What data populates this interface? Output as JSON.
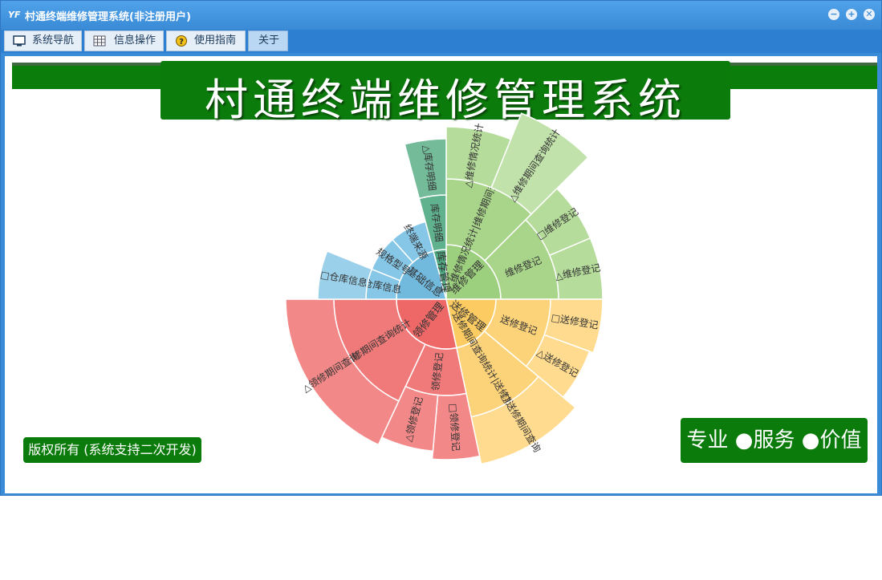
{
  "window": {
    "title": "村通终端维修管理系统(非注册用户)",
    "app_icon": "YF",
    "minimize_glyph": "−",
    "maximize_glyph": "+",
    "close_glyph": "✕"
  },
  "menu": {
    "tabs": [
      {
        "label": "系统导航",
        "icon": "monitor-icon"
      },
      {
        "label": "信息操作",
        "icon": "grid-icon"
      },
      {
        "label": "使用指南",
        "icon": "help-icon"
      },
      {
        "label": "关于",
        "icon": ""
      }
    ]
  },
  "banner": {
    "title": "村通终端维修管理系统"
  },
  "footer": {
    "copyright": "版权所有 (系统支持二次开发)",
    "slogan": "专业 ●服务 ●价值"
  },
  "sunburst": {
    "inner": [
      {
        "label": "维修管理",
        "color": "#9ccf7e"
      },
      {
        "label": "送修管理",
        "color": "#fccc62"
      },
      {
        "label": "领修管理",
        "color": "#ee6868"
      },
      {
        "label": "基础信息",
        "color": "#71bade"
      },
      {
        "label": "库存管理",
        "color": "#4fa882"
      }
    ],
    "middle": [
      {
        "label": "维修情况统计|维修期间查询统计",
        "color": "#a8d58a"
      },
      {
        "label": "维修登记",
        "color": "#a8d58a"
      },
      {
        "label": "送修登记",
        "color": "#fdd37a"
      },
      {
        "label": "送修期间查询统计|送修期间查询",
        "color": "#fdd37a"
      },
      {
        "label": "领修登记",
        "color": "#f07a7a"
      },
      {
        "label": "领修期间查询统计",
        "color": "#f07a7a"
      },
      {
        "label": "仓库信息",
        "color": "#86c6e6"
      },
      {
        "label": "规格型号",
        "color": "#86c6e6"
      },
      {
        "label": "终端来源",
        "color": "#86c6e6"
      },
      {
        "label": "库存明细",
        "color": "#60b18e"
      }
    ],
    "outer": [
      {
        "label": "维修情况统计",
        "prefix": "△",
        "color": "#b5dc9b"
      },
      {
        "label": "维修期间查询统计",
        "prefix": "△",
        "color": "#c1e2aa"
      },
      {
        "label": "维修登记",
        "prefix": "□",
        "color": "#b5dc9b"
      },
      {
        "label": "维修登记",
        "prefix": "△",
        "color": "#b5dc9b"
      },
      {
        "label": "送修登记",
        "prefix": "□",
        "color": "#fedb8e"
      },
      {
        "label": "送修登记",
        "prefix": "△",
        "color": "#fedb8e"
      },
      {
        "label": "送修期间查询",
        "prefix": "□",
        "color": "#fedb8e"
      },
      {
        "label": "领修登记",
        "prefix": "□",
        "color": "#f38888"
      },
      {
        "label": "领修登记",
        "prefix": "△",
        "color": "#f38888"
      },
      {
        "label": "领修期间查询",
        "prefix": "△",
        "color": "#f38888"
      },
      {
        "label": "仓库信息",
        "prefix": "□",
        "color": "#9bd0ea"
      },
      {
        "label": "库存明细",
        "prefix": "△",
        "color": "#74bb9a"
      }
    ]
  }
}
